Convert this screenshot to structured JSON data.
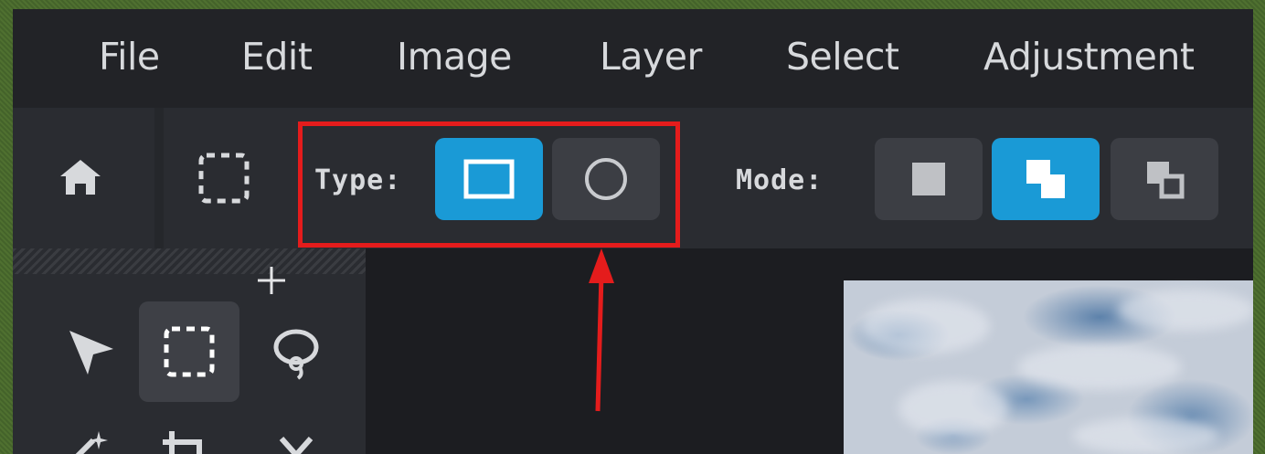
{
  "menubar": {
    "items": [
      "File",
      "Edit",
      "Image",
      "Layer",
      "Select",
      "Adjustment"
    ]
  },
  "toolbar": {
    "type_label": "Type:",
    "mode_label": "Mode:",
    "type_options": [
      {
        "name": "rectangle",
        "icon": "rectangle-icon",
        "selected": true
      },
      {
        "name": "ellipse",
        "icon": "circle-icon",
        "selected": false
      }
    ],
    "mode_options": [
      {
        "name": "new-selection",
        "icon": "square-icon",
        "selected": false
      },
      {
        "name": "add-selection",
        "icon": "union-icon",
        "selected": true
      },
      {
        "name": "subtract-selection",
        "icon": "subtract-icon",
        "selected": false
      }
    ]
  },
  "tools": [
    "move-tool",
    "rectangle-select-tool",
    "lasso-tool",
    "magic-wand-tool",
    "crop-tool",
    "cut-tool"
  ],
  "colors": {
    "accent": "#1a9ad6",
    "highlight": "#e41c1c"
  }
}
